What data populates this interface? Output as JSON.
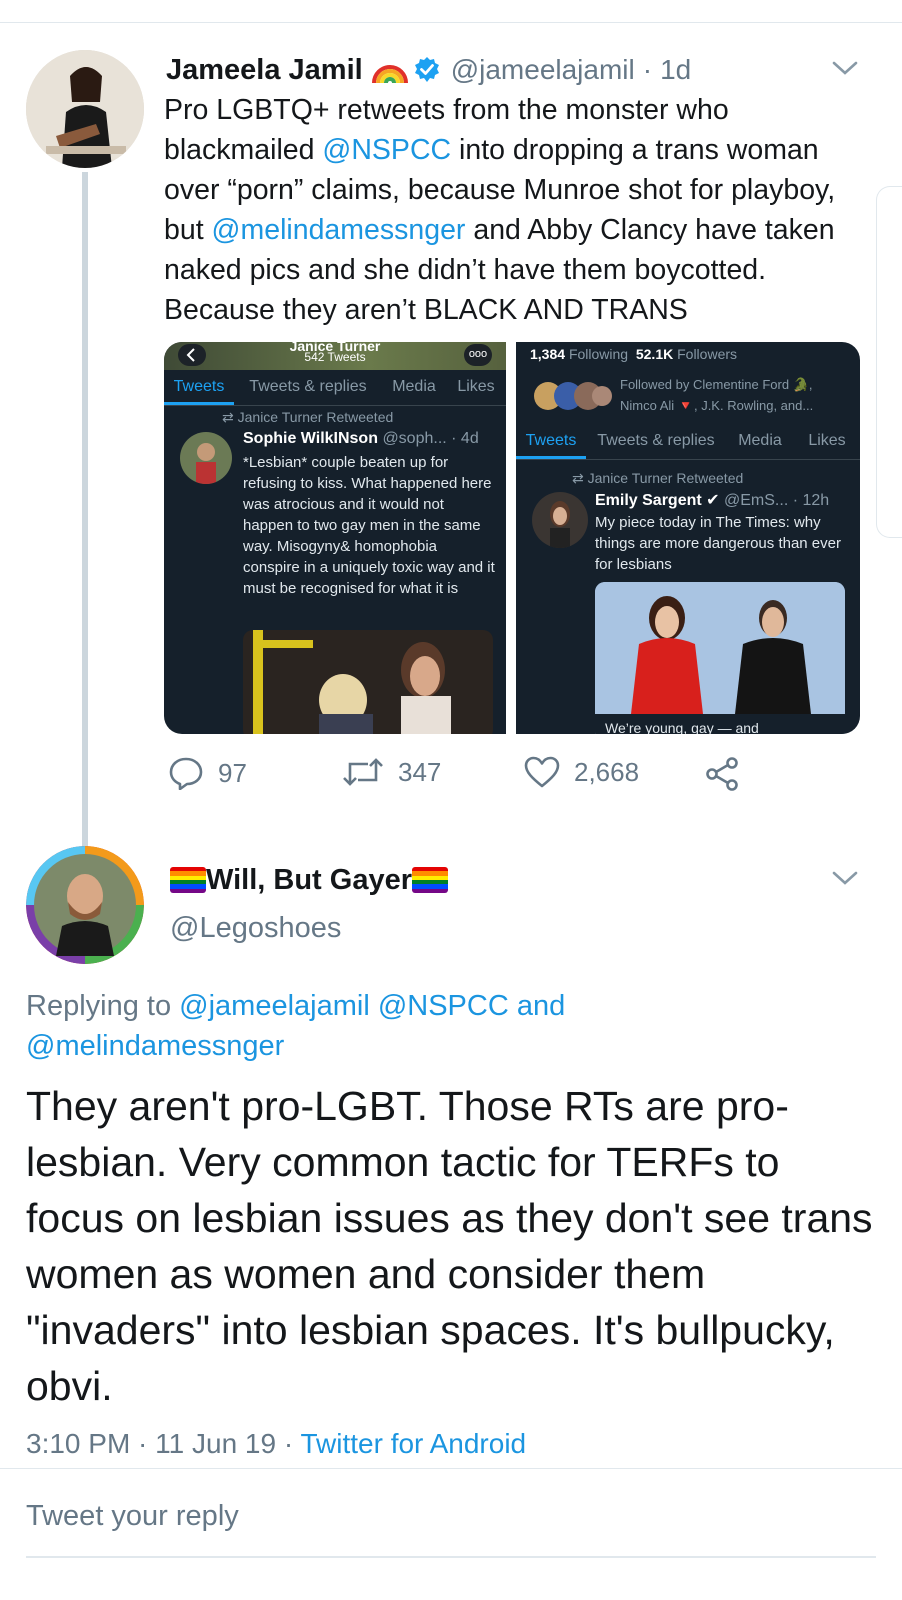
{
  "parent": {
    "name": "Jameela Jamil",
    "handle": "@jameelajamil",
    "dot": "·",
    "time": "1d",
    "text_parts": {
      "t1": "Pro LGBTQ+ retweets from the monster who blackmailed ",
      "mention1": "@NSPCC",
      "t2": " into dropping a trans woman over “porn” claims, because Munroe shot for playboy, but ",
      "mention2": "@melindamessnger",
      "t3": " and Abby Clancy have taken naked pics and she didn’t have them boycotted. Because they aren’t BLACK AND TRANS"
    },
    "media": {
      "left": {
        "banner_name": "Janice Turner",
        "banner_tweets": "542 Tweets",
        "more": "ooo",
        "tabs": [
          "Tweets",
          "Tweets & replies",
          "Media",
          "Likes"
        ],
        "retweeted_by": "Janice Turner Retweeted",
        "tweet_name": "Sophie WilkINson",
        "tweet_meta": "@soph... · 4d",
        "tweet_text": "*Lesbian* couple beaten up for refusing to kiss. What happened here was atrocious and it would not happen to two gay men in the same way. Misogyny& homophobia conspire in a uniquely toxic way and it must be recognised for what it is"
      },
      "right": {
        "following_count": "1,384",
        "following_label": "Following",
        "followers_count": "52.1K",
        "followers_label": "Followers",
        "followed_by": "Followed by Clementine Ford 🐊, Nimco Ali 🔻, J.K. Rowling, and...",
        "tabs": [
          "Tweets",
          "Tweets & replies",
          "Media",
          "Likes"
        ],
        "retweeted_by": "Janice Turner Retweeted",
        "tweet_name": "Emily Sargent",
        "tweet_meta": "@EmS... · 12h",
        "tweet_text": "My piece today in The Times: why things are more dangerous than ever for lesbians",
        "article_caption": "We’re young, gay — and"
      }
    },
    "stats": {
      "replies": "97",
      "retweets": "347",
      "likes": "2,668"
    }
  },
  "reply": {
    "name": "Will, But Gayer",
    "handle": "@Legoshoes",
    "replying_label": "Replying to ",
    "replying_mentions": "@jameelajamil @NSPCC and @melindamessnger",
    "text": "They aren't pro-LGBT. Those RTs are pro-lesbian. Very common tactic for TERFs to focus on lesbian issues as they don't see trans women as women and consider them \"invaders\" into lesbian spaces. It's bullpucky, obvi.",
    "time": "3:10 PM · 11 Jun 19 · ",
    "client": "Twitter for Android"
  },
  "composer": {
    "placeholder": "Tweet your reply"
  },
  "colors": {
    "link": "#1b95e0",
    "muted": "#657786",
    "verified": "#1da1f2",
    "dark_bg": "#15202b"
  },
  "icons": [
    "rainbow-emoji-icon",
    "verified-badge-icon",
    "chevron-down-icon",
    "reply-icon",
    "retweet-icon",
    "like-icon",
    "share-icon",
    "rainbow-flag-icon"
  ]
}
